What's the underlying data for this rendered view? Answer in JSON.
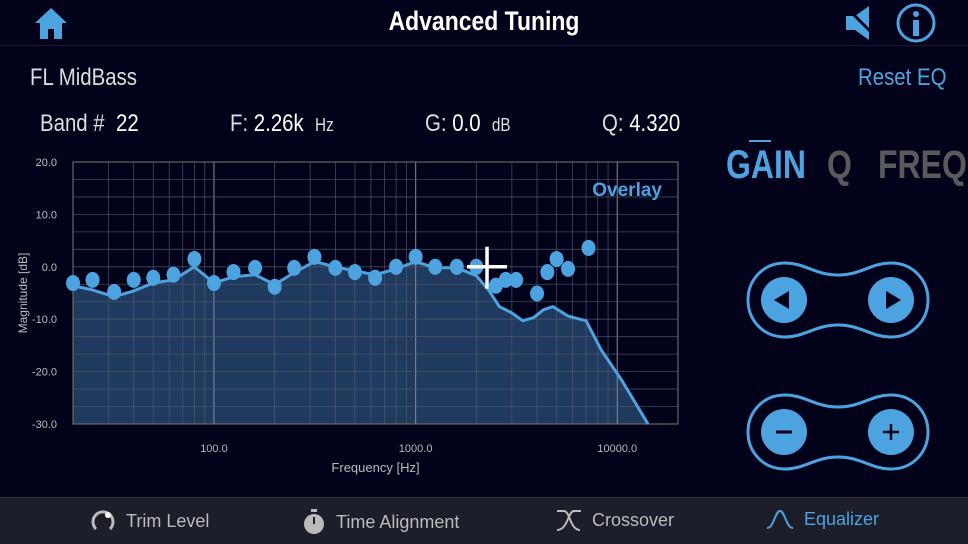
{
  "header": {
    "title": "Advanced Tuning",
    "home_icon": "home-icon",
    "speaker_icon": "speaker-mute-icon",
    "info_icon": "info-icon"
  },
  "channel": "FL MidBass",
  "reset_label": "Reset EQ",
  "band": {
    "band_label": "Band #",
    "band_value": "22",
    "f_label": "F:",
    "f_value": "2.26k",
    "f_unit": "Hz",
    "g_label": "G:",
    "g_value": "0.0",
    "g_unit": "dB",
    "q_label": "Q:",
    "q_value": "4.320"
  },
  "modes": [
    {
      "label": "GAIN",
      "active": true
    },
    {
      "label": "Q",
      "active": false
    },
    {
      "label": "FREQ",
      "active": false
    }
  ],
  "colors": {
    "accent": "#4da3e0",
    "fill": "#1f3a5e",
    "inactive": "#5a5a5a",
    "background": "#02031a"
  },
  "chart_data": {
    "type": "line",
    "xlabel": "Frequency [Hz]",
    "ylabel": "Magnitude [dB]",
    "xscale": "log",
    "xlim": [
      20,
      20000
    ],
    "ylim": [
      -30,
      20
    ],
    "yticks": [
      "20.0",
      "10.0",
      "0.0",
      "-10.0",
      "-20.0",
      "-30.0"
    ],
    "ytick_values": [
      20,
      10,
      0,
      -10,
      -20,
      -30
    ],
    "xticks": [
      "100.0",
      "1000.0",
      "10000.0"
    ],
    "xtick_values": [
      100,
      1000,
      10000
    ],
    "grid": true,
    "overlay_label": "Overlay",
    "selected_band": {
      "freq": 2260,
      "gain": 0.0
    },
    "bands": [
      [
        20,
        -3.1
      ],
      [
        25,
        -2.5
      ],
      [
        32,
        -4.8
      ],
      [
        40,
        -2.5
      ],
      [
        50,
        -2.1
      ],
      [
        63,
        -1.5
      ],
      [
        80,
        1.5
      ],
      [
        100,
        -3.1
      ],
      [
        125,
        -1.0
      ],
      [
        160,
        -0.2
      ],
      [
        200,
        -3.8
      ],
      [
        250,
        -0.2
      ],
      [
        315,
        1.9
      ],
      [
        400,
        -0.2
      ],
      [
        500,
        -1.0
      ],
      [
        630,
        -2.1
      ],
      [
        800,
        0
      ],
      [
        1000,
        1.9
      ],
      [
        1250,
        0
      ],
      [
        1600,
        0
      ],
      [
        2000,
        0
      ],
      [
        2500,
        -3.6
      ],
      [
        2800,
        -2.5
      ],
      [
        3150,
        -2.5
      ],
      [
        4000,
        -5.1
      ],
      [
        4500,
        -1.0
      ],
      [
        5000,
        1.5
      ],
      [
        5700,
        -0.4
      ],
      [
        7200,
        3.6
      ]
    ],
    "response": [
      [
        20,
        -3.6
      ],
      [
        25,
        -4.4
      ],
      [
        32,
        -5.7
      ],
      [
        40,
        -4.6
      ],
      [
        50,
        -3.1
      ],
      [
        63,
        -2.5
      ],
      [
        80,
        0
      ],
      [
        100,
        -3.1
      ],
      [
        125,
        -1.9
      ],
      [
        160,
        -1.5
      ],
      [
        200,
        -3.4
      ],
      [
        250,
        -1.1
      ],
      [
        315,
        1.0
      ],
      [
        400,
        0
      ],
      [
        500,
        -0.8
      ],
      [
        630,
        -1.5
      ],
      [
        800,
        -0.4
      ],
      [
        1000,
        1.0
      ],
      [
        1250,
        -0.2
      ],
      [
        1600,
        -0.2
      ],
      [
        2000,
        -1.7
      ],
      [
        2300,
        -4.4
      ],
      [
        2600,
        -7.6
      ],
      [
        3000,
        -8.8
      ],
      [
        3400,
        -10.3
      ],
      [
        3850,
        -9.7
      ],
      [
        4300,
        -8.2
      ],
      [
        4800,
        -7.6
      ],
      [
        5700,
        -9.4
      ],
      [
        7000,
        -10.3
      ],
      [
        8300,
        -15.8
      ],
      [
        10500,
        -21.6
      ],
      [
        14200,
        -30
      ]
    ]
  },
  "nav": [
    {
      "label": "Trim Level",
      "icon": "trim-knob-icon"
    },
    {
      "label": "Time Alignment",
      "icon": "stopwatch-icon"
    },
    {
      "label": "Crossover",
      "icon": "crossover-icon"
    },
    {
      "label": "Equalizer",
      "icon": "equalizer-icon",
      "active": true
    }
  ]
}
